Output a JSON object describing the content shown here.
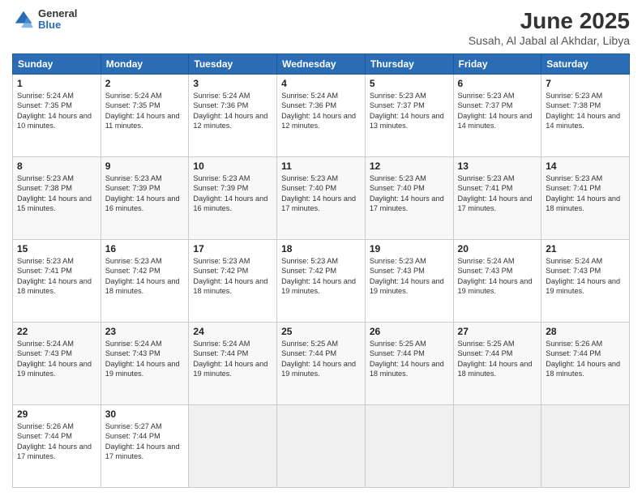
{
  "header": {
    "logo_general": "General",
    "logo_blue": "Blue",
    "main_title": "June 2025",
    "subtitle": "Susah, Al Jabal al Akhdar, Libya"
  },
  "calendar": {
    "headers": [
      "Sunday",
      "Monday",
      "Tuesday",
      "Wednesday",
      "Thursday",
      "Friday",
      "Saturday"
    ],
    "rows": [
      [
        {
          "day": "1",
          "sunrise": "5:24 AM",
          "sunset": "7:35 PM",
          "daylight": "14 hours and 10 minutes."
        },
        {
          "day": "2",
          "sunrise": "5:24 AM",
          "sunset": "7:35 PM",
          "daylight": "14 hours and 11 minutes."
        },
        {
          "day": "3",
          "sunrise": "5:24 AM",
          "sunset": "7:36 PM",
          "daylight": "14 hours and 12 minutes."
        },
        {
          "day": "4",
          "sunrise": "5:24 AM",
          "sunset": "7:36 PM",
          "daylight": "14 hours and 12 minutes."
        },
        {
          "day": "5",
          "sunrise": "5:23 AM",
          "sunset": "7:37 PM",
          "daylight": "14 hours and 13 minutes."
        },
        {
          "day": "6",
          "sunrise": "5:23 AM",
          "sunset": "7:37 PM",
          "daylight": "14 hours and 14 minutes."
        },
        {
          "day": "7",
          "sunrise": "5:23 AM",
          "sunset": "7:38 PM",
          "daylight": "14 hours and 14 minutes."
        }
      ],
      [
        {
          "day": "8",
          "sunrise": "5:23 AM",
          "sunset": "7:38 PM",
          "daylight": "14 hours and 15 minutes."
        },
        {
          "day": "9",
          "sunrise": "5:23 AM",
          "sunset": "7:39 PM",
          "daylight": "14 hours and 16 minutes."
        },
        {
          "day": "10",
          "sunrise": "5:23 AM",
          "sunset": "7:39 PM",
          "daylight": "14 hours and 16 minutes."
        },
        {
          "day": "11",
          "sunrise": "5:23 AM",
          "sunset": "7:40 PM",
          "daylight": "14 hours and 17 minutes."
        },
        {
          "day": "12",
          "sunrise": "5:23 AM",
          "sunset": "7:40 PM",
          "daylight": "14 hours and 17 minutes."
        },
        {
          "day": "13",
          "sunrise": "5:23 AM",
          "sunset": "7:41 PM",
          "daylight": "14 hours and 17 minutes."
        },
        {
          "day": "14",
          "sunrise": "5:23 AM",
          "sunset": "7:41 PM",
          "daylight": "14 hours and 18 minutes."
        }
      ],
      [
        {
          "day": "15",
          "sunrise": "5:23 AM",
          "sunset": "7:41 PM",
          "daylight": "14 hours and 18 minutes."
        },
        {
          "day": "16",
          "sunrise": "5:23 AM",
          "sunset": "7:42 PM",
          "daylight": "14 hours and 18 minutes."
        },
        {
          "day": "17",
          "sunrise": "5:23 AM",
          "sunset": "7:42 PM",
          "daylight": "14 hours and 18 minutes."
        },
        {
          "day": "18",
          "sunrise": "5:23 AM",
          "sunset": "7:42 PM",
          "daylight": "14 hours and 19 minutes."
        },
        {
          "day": "19",
          "sunrise": "5:23 AM",
          "sunset": "7:43 PM",
          "daylight": "14 hours and 19 minutes."
        },
        {
          "day": "20",
          "sunrise": "5:24 AM",
          "sunset": "7:43 PM",
          "daylight": "14 hours and 19 minutes."
        },
        {
          "day": "21",
          "sunrise": "5:24 AM",
          "sunset": "7:43 PM",
          "daylight": "14 hours and 19 minutes."
        }
      ],
      [
        {
          "day": "22",
          "sunrise": "5:24 AM",
          "sunset": "7:43 PM",
          "daylight": "14 hours and 19 minutes."
        },
        {
          "day": "23",
          "sunrise": "5:24 AM",
          "sunset": "7:43 PM",
          "daylight": "14 hours and 19 minutes."
        },
        {
          "day": "24",
          "sunrise": "5:24 AM",
          "sunset": "7:44 PM",
          "daylight": "14 hours and 19 minutes."
        },
        {
          "day": "25",
          "sunrise": "5:25 AM",
          "sunset": "7:44 PM",
          "daylight": "14 hours and 19 minutes."
        },
        {
          "day": "26",
          "sunrise": "5:25 AM",
          "sunset": "7:44 PM",
          "daylight": "14 hours and 18 minutes."
        },
        {
          "day": "27",
          "sunrise": "5:25 AM",
          "sunset": "7:44 PM",
          "daylight": "14 hours and 18 minutes."
        },
        {
          "day": "28",
          "sunrise": "5:26 AM",
          "sunset": "7:44 PM",
          "daylight": "14 hours and 18 minutes."
        }
      ],
      [
        {
          "day": "29",
          "sunrise": "5:26 AM",
          "sunset": "7:44 PM",
          "daylight": "14 hours and 17 minutes."
        },
        {
          "day": "30",
          "sunrise": "5:27 AM",
          "sunset": "7:44 PM",
          "daylight": "14 hours and 17 minutes."
        },
        null,
        null,
        null,
        null,
        null
      ]
    ]
  }
}
